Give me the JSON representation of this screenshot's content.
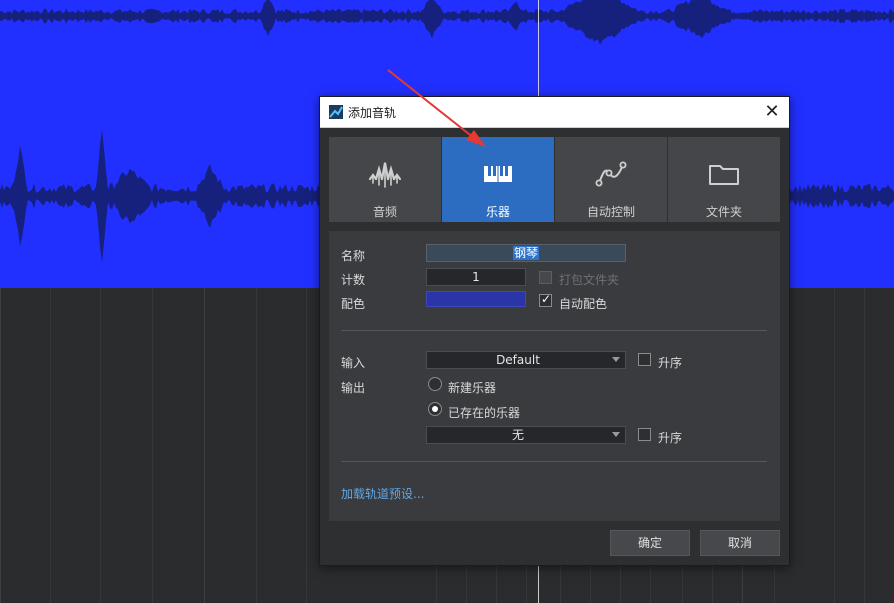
{
  "dialog": {
    "title": "添加音轨",
    "close_symbol": "✕"
  },
  "tabs": [
    {
      "label": "音频",
      "icon": "audio-wave-icon",
      "active": false
    },
    {
      "label": "乐器",
      "icon": "piano-keys-icon",
      "active": true
    },
    {
      "label": "自动控制",
      "icon": "automation-curve-icon",
      "active": false
    },
    {
      "label": "文件夹",
      "icon": "folder-icon",
      "active": false
    }
  ],
  "form": {
    "name_label": "名称",
    "name_value": "钢琴",
    "count_label": "计数",
    "count_value": "1",
    "pack_folder_label": "打包文件夹",
    "pack_folder_checked": false,
    "pack_folder_enabled": false,
    "color_label": "配色",
    "color_value": "#2a36a8",
    "auto_color_label": "自动配色",
    "auto_color_checked": true,
    "input_label": "输入",
    "input_value": "Default",
    "input_ascending_label": "升序",
    "input_ascending_checked": false,
    "output_label": "输出",
    "new_instrument_label": "新建乐器",
    "new_instrument_selected": false,
    "existing_instrument_label": "已存在的乐器",
    "existing_instrument_selected": true,
    "output_value": "无",
    "output_ascending_label": "升序",
    "output_ascending_checked": false,
    "load_preset_link": "加载轨道预设..."
  },
  "buttons": {
    "ok_label": "确定",
    "cancel_label": "取消"
  },
  "colors": {
    "waveform_bg": "#2230ff",
    "waveform_fg": "#14206e",
    "active_tab": "#2c6dc2",
    "annotation_arrow": "#e53935",
    "link": "#5fa7e8"
  }
}
